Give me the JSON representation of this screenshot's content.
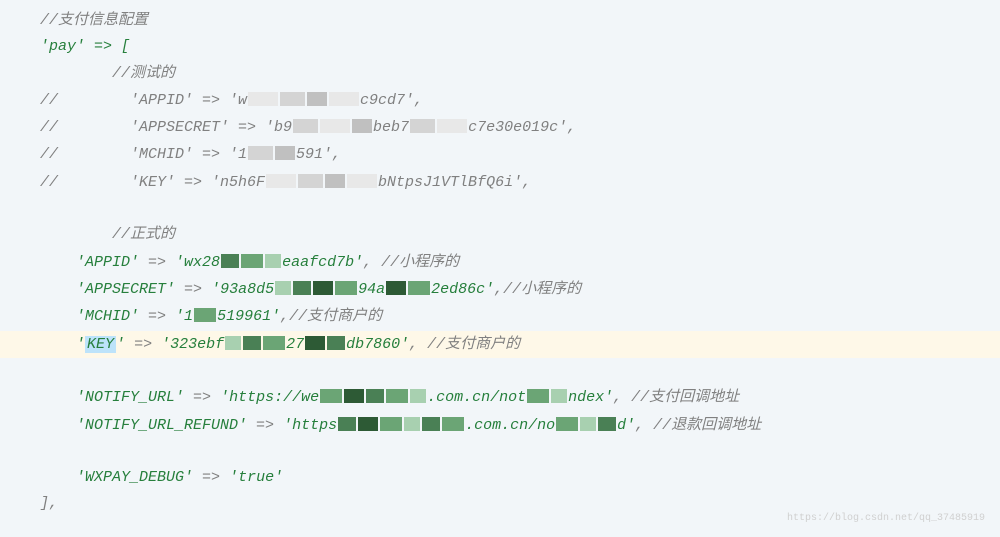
{
  "lines": {
    "comment_header": "//支付信息配置",
    "pay_open": "'pay' => [",
    "comment_test": "//测试的",
    "test_appid_prefix": "//        'APPID' => 'w",
    "test_appid_suffix": "c9cd7',",
    "test_appsecret_prefix": "//        'APPSECRET' => 'b9",
    "test_appsecret_mid": "beb7",
    "test_appsecret_suffix": "c7e30e019c',",
    "test_mchid_prefix": "//        'MCHID' => '1",
    "test_mchid_suffix": "591',",
    "test_key_prefix": "//        'KEY' => 'n5h6F",
    "test_key_mid": "bNtpsJ1VTlBfQ6i',",
    "comment_prod": "//正式的",
    "prod_appid_key": "'APPID'",
    "prod_appid_val_prefix": "'wx28",
    "prod_appid_val_suffix": "eaafcd7b'",
    "prod_appid_comment": ", //小程序的",
    "prod_appsecret_key": "'APPSECRET'",
    "prod_appsecret_val_prefix": "'93a8d5",
    "prod_appsecret_val_mid": "94a",
    "prod_appsecret_val_suffix": "2ed86c'",
    "prod_appsecret_comment": ",//小程序的",
    "prod_mchid_key": "'MCHID'",
    "prod_mchid_val_prefix": "'1",
    "prod_mchid_val_suffix": "519961'",
    "prod_mchid_comment": ",//支付商户的",
    "prod_key_key": "KEY",
    "prod_key_val_prefix": "'323ebf",
    "prod_key_val_mid": "27",
    "prod_key_val_suffix": "db7860'",
    "prod_key_comment": ", //支付商户的",
    "notify_url_key": "'NOTIFY_URL'",
    "notify_url_val_prefix": "'https://we",
    "notify_url_val_mid": ".com.cn/not",
    "notify_url_val_suffix": "ndex'",
    "notify_url_comment": ", //支付回调地址",
    "notify_refund_key": "'NOTIFY_URL_REFUND'",
    "notify_refund_val_prefix": "'https",
    "notify_refund_val_mid": ".com.cn/no",
    "notify_refund_val_suffix": "d'",
    "notify_refund_comment": ", //退款回调地址",
    "wxpay_debug_key": "'WXPAY_DEBUG'",
    "wxpay_debug_val": "'true'",
    "close": "],",
    "arrow": " => "
  },
  "watermark": "https://blog.csdn.net/qq_37485919"
}
